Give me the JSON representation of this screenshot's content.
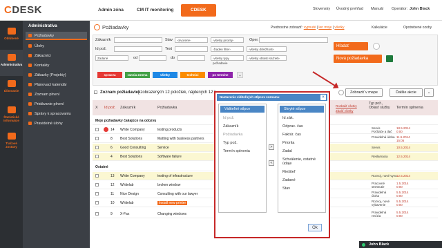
{
  "topbar": {
    "logo": "CDESK",
    "nav": [
      "Admin zóna",
      "CM IT monitoring",
      "CDESK"
    ],
    "links": [
      "Slovensky",
      "Úvodný prehľad",
      "Manuál"
    ],
    "operator_label": "Operátor:",
    "operator_name": "John Black"
  },
  "iconbar": [
    "Oblúbené",
    "Administratíva",
    "Účtovanie",
    "Štatistické informácie",
    "Tlačové zostavy"
  ],
  "sidemenu": {
    "title": "Administratíva",
    "items": [
      "Požiadavky",
      "Úlohy",
      "Zákazníci",
      "Kontakty",
      "Zákazky (Projekty)",
      "Plánovací kalendár",
      "Zoznam plnení",
      "Pridávanie plnení",
      "Správy k spracovaniu",
      "Pravidelné úlohy"
    ]
  },
  "main": {
    "title": "Požiadavky",
    "prefs_label": "Prednostne zobraziť:",
    "prefs_links": [
      "vypnuté",
      "len moje",
      "všetky"
    ],
    "prefs_extra": [
      "Kalkulácie",
      "Opotrebené ozoby"
    ]
  },
  "filters": {
    "labels": [
      "Zákazník",
      "Stav",
      "Oper.",
      "Id pož.",
      "Text",
      "Zadané",
      "od",
      "do"
    ],
    "selects": [
      "-otvorené-",
      "-všetky priority-",
      "-žiaden filter-",
      "-všetky dôležitosti-",
      "-všetky typy požiadavie",
      "-všetky oblasti služieb-"
    ],
    "tags": [
      {
        "label": "spracva",
        "color": "#e53935"
      },
      {
        "label": "rannia zmena",
        "color": "#43a047"
      },
      {
        "label": "všetky",
        "color": "#1e88e5"
      },
      {
        "label": "technici",
        "color": "#fb8c00"
      },
      {
        "label": "po termíne",
        "color": "#8e24aa"
      }
    ],
    "search_button": "Hľadať",
    "new_button": "Nová požiadavka"
  },
  "grid_header": {
    "list_title": "Zoznam požiadaviek",
    "list_info": "[ zobrazených 12 položiek, nájdených 12 ]",
    "map_button": "Zobraziť v mape",
    "more_button": "Ďalšie akcie"
  },
  "table": {
    "headers": [
      "X",
      "Id pož.",
      "Zákazník",
      "Požiadavka",
      "Typ pož., Oblasť služby",
      "Termín splnenia"
    ],
    "sort_links": [
      "Rozbaliť všetky",
      "Zbaliť všetky"
    ],
    "groups": [
      "Moje požiadavky čakajúce na odozvu",
      "Ostatné"
    ],
    "rows": [
      {
        "id": "14",
        "customer": "White Company",
        "request": "testing products",
        "type": "Servis",
        "type2": "Počítače a tlač",
        "date": "18.5.2014",
        "time": "0:00"
      },
      {
        "id": "8",
        "customer": "Best Solutions",
        "request": "Matting with business partners",
        "type": "Pravidelná úloha",
        "type2": "",
        "date": "11.5.2014",
        "time": "15:05"
      },
      {
        "id": "6",
        "customer": "Good Consulting",
        "request": "Service",
        "type": "Servis",
        "type2": "",
        "date": "10.5.2014",
        "time": ""
      },
      {
        "id": "4",
        "customer": "Best Solutions",
        "request": "Software failure",
        "type": "Reklamácia",
        "type2": "",
        "date": "12.5.2014",
        "time": ""
      },
      {
        "id": "13",
        "customer": "White Company",
        "request": "testing of infrastructure",
        "type": "Rozvoj, nové vyvo",
        "type2": "",
        "date": "12.5.2014",
        "time": ""
      },
      {
        "id": "12",
        "customer": "Whitelab",
        "request": "broken window",
        "type": "Pracovné",
        "type2": "stretnutie",
        "date": "1.5.2014",
        "time": "0:00"
      },
      {
        "id": "11",
        "customer": "Nice Design",
        "request": "Consulting with our lawyer",
        "type": "Pravidelná",
        "type2": "úloha",
        "date": "5.5.2014",
        "time": "0:00"
      },
      {
        "id": "10",
        "customer": "Whitelab",
        "request": "Install new printer",
        "type": "Rozvoj, nové",
        "type2": "vybavenie",
        "date": "5.5.2014",
        "time": "0:00"
      },
      {
        "id": "9",
        "customer": "X-Fax",
        "request": "Changing windows",
        "type": "Pravidelná",
        "type2": "revízia",
        "date": "5.5.2014",
        "time": "0:00"
      }
    ]
  },
  "modal": {
    "title": "Nastavenie viditeľných stĺpcov zoznamu",
    "visible_head": "Viditeľné stĺpce",
    "visible_items": [
      "Id pož.",
      "Zákazník",
      "Požiadavka",
      "Typ pož.",
      "Termín splnenia"
    ],
    "hidden_head": "Skryté stĺpce",
    "hidden_items": [
      "Id zák.",
      "Odprac. čas",
      "Faktúr. čas",
      "Priorita",
      "Zadal",
      "Schválenie, ostatné údaje",
      "Riešiteľ",
      "Zadané",
      "Stav"
    ],
    "move_right": ">",
    "move_left": "<",
    "ok": "Ok",
    "close": "×"
  },
  "chat": {
    "name": "John Black"
  }
}
